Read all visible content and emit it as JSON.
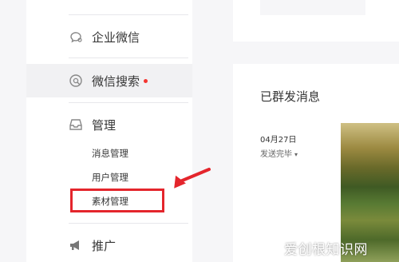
{
  "sidebar": {
    "enterprise_wechat": "企业微信",
    "wechat_search": "微信搜索",
    "manage": "管理",
    "message_manage": "消息管理",
    "user_manage": "用户管理",
    "material_manage": "素材管理",
    "promote": "推广"
  },
  "main": {
    "section_title": "已群发消息",
    "message_date": "04月27日",
    "message_status": "发送完毕",
    "status_caret": "▾"
  },
  "watermark": "爱创根知识网",
  "colors": {
    "highlight": "#e4252c",
    "red_dot": "#f43530",
    "sidebar_bg": "#ffffff",
    "page_bg": "#f6f6f8"
  },
  "icons": [
    "enterprise-wechat-icon",
    "wechat-search-icon",
    "inbox-icon",
    "megaphone-icon"
  ]
}
